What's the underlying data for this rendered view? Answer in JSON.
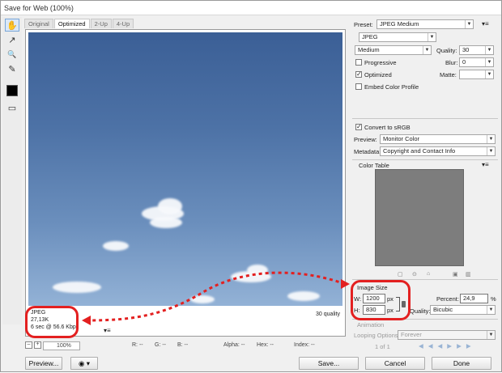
{
  "window": {
    "title": "Save for Web (100%)"
  },
  "tools": [
    "hand-tool",
    "slice-select-tool",
    "zoom-tool",
    "eyedropper-tool",
    "eyedropper-color",
    "toggle-slices-visibility"
  ],
  "tools_glyphs": [
    "✋",
    "↗",
    "🔍",
    "✎",
    "",
    "▭"
  ],
  "tabs": [
    "Original",
    "Optimized",
    "2-Up",
    "4-Up"
  ],
  "preview": {
    "format": "JPEG",
    "size": "27,13K",
    "download": "6 sec @ 56.6 Kbps",
    "quality": "30 quality"
  },
  "status": {
    "zoom": "100%",
    "r": "R: --",
    "g": "G: --",
    "b": "B: --",
    "alpha": "Alpha: --",
    "hex": "Hex: --",
    "index": "Index: --"
  },
  "settings": {
    "preset_label": "Preset:",
    "preset": "JPEG Medium",
    "format": "JPEG",
    "quality_level": "Medium",
    "quality_label": "Quality:",
    "quality": "30",
    "progressive": "Progressive",
    "blur_label": "Blur:",
    "blur": "0",
    "optimized": "Optimized",
    "matte_label": "Matte:",
    "matte": "",
    "embed_profile": "Embed Color Profile",
    "convert_srgb": "Convert to sRGB",
    "preview_label": "Preview:",
    "preview": "Monitor Color",
    "metadata_label": "Metadata:",
    "metadata": "Copyright and Contact Info",
    "color_table": "Color Table"
  },
  "image_size": {
    "title": "Image Size",
    "w_label": "W:",
    "w": "1200",
    "h_label": "H:",
    "h": "830",
    "unit": "px",
    "percent_label": "Percent:",
    "percent": "24,9",
    "percent_unit": "%",
    "quality_label": "Quality:",
    "quality": "Bicubic"
  },
  "animation": {
    "title": "Animation",
    "looping_label": "Looping Options:",
    "looping": "Forever",
    "frame": "1 of 1"
  },
  "buttons": {
    "preview": "Preview...",
    "save": "Save...",
    "cancel": "Cancel",
    "done": "Done"
  },
  "colors": {
    "highlight": "#e32020",
    "accent": "#7aa7d8"
  }
}
